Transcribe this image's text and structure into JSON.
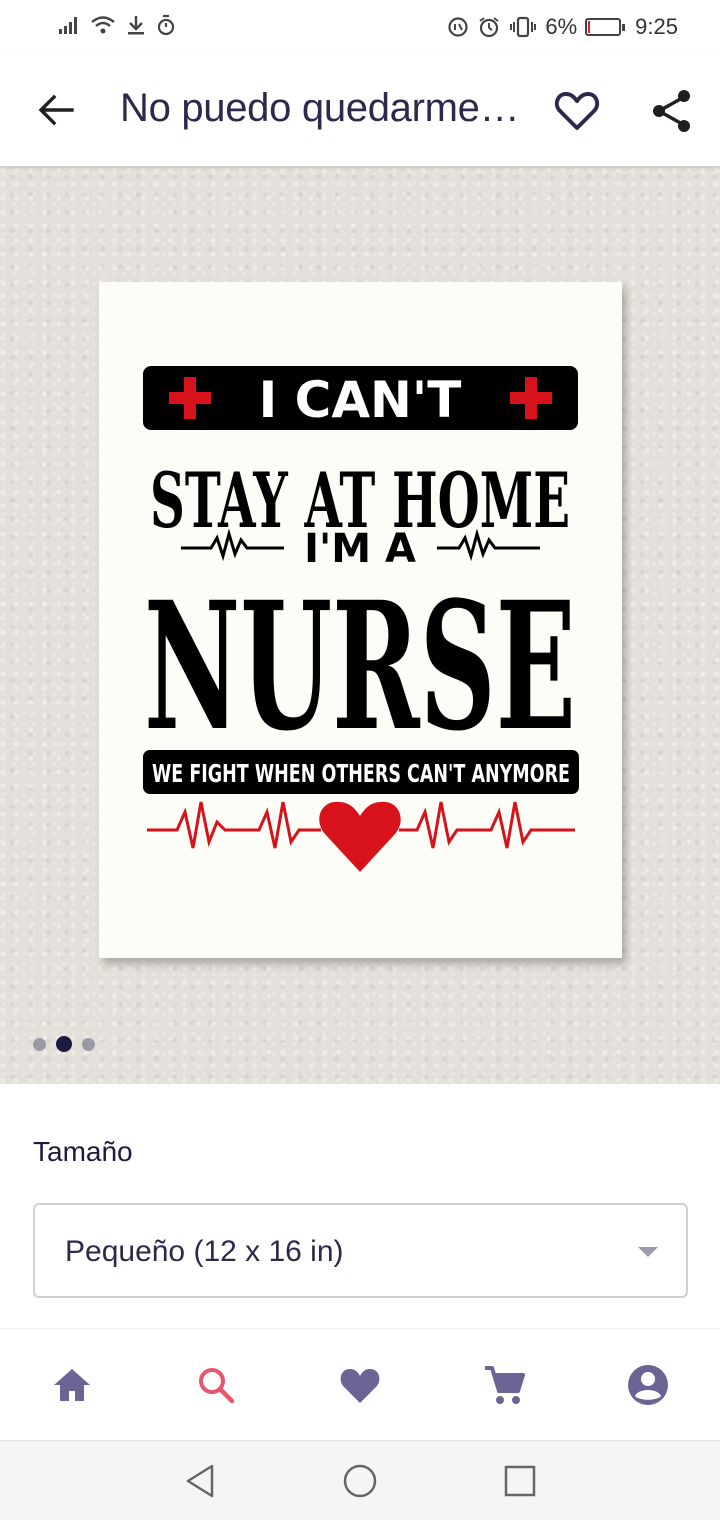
{
  "status_bar": {
    "battery": "6%",
    "time": "9:25"
  },
  "app_bar": {
    "title": "No puedo quedarme…",
    "back_icon": "arrow-left-icon",
    "favorite_icon": "heart-outline-icon",
    "share_icon": "share-icon"
  },
  "poster": {
    "line1": "I CAN'T",
    "line2": "STAY AT HOME",
    "line3": "I'M A",
    "line4": "NURSE",
    "line5": "WE FIGHT WHEN OTHERS CAN'T ANYMORE"
  },
  "carousel": {
    "count": 3,
    "active_index": 1
  },
  "options": {
    "size_label": "Tamaño",
    "size_value": "Pequeño (12 x 16 in)"
  },
  "bottom_nav": {
    "items": [
      {
        "icon": "home-icon",
        "active": false
      },
      {
        "icon": "search-icon",
        "active": true
      },
      {
        "icon": "heart-icon",
        "active": false
      },
      {
        "icon": "cart-icon",
        "active": false
      },
      {
        "icon": "account-icon",
        "active": false
      }
    ]
  },
  "colors": {
    "nav_icon": "#6a6594",
    "nav_active": "#e8566c",
    "title": "#2b2a4c",
    "poster_red": "#d8121a"
  }
}
